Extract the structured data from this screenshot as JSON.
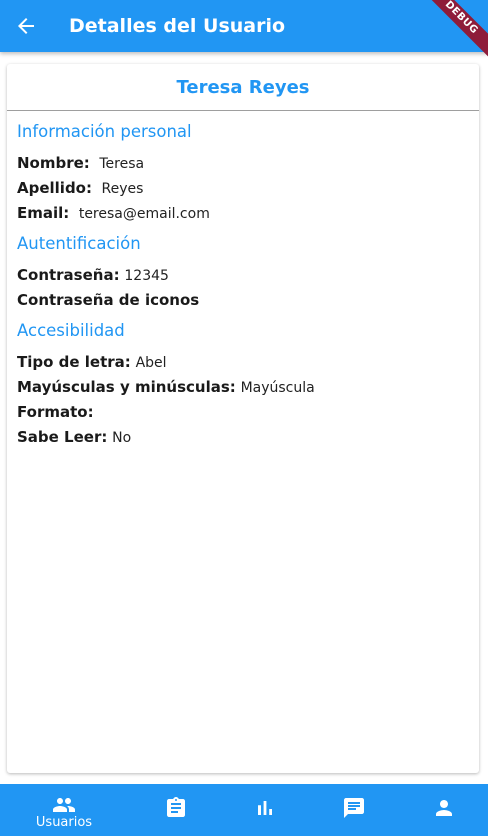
{
  "appbar": {
    "title": "Detalles del Usuario",
    "back_icon": "arrow-back-icon",
    "color": "#2196f3",
    "debug_label": "DEBUG"
  },
  "user": {
    "full_name": "Teresa Reyes"
  },
  "sections": {
    "personal": {
      "title": "Información personal",
      "nombre_label": "Nombre:",
      "nombre_value": "Teresa",
      "apellido_label": "Apellido:",
      "apellido_value": "Reyes",
      "email_label": "Email:",
      "email_value": "teresa@email.com"
    },
    "auth": {
      "title": "Autentificación",
      "password_label": "Contraseña:",
      "password_value": "12345",
      "icon_password_label": "Contraseña de iconos"
    },
    "accessibility": {
      "title": "Accesibilidad",
      "font_label": "Tipo de letra:",
      "font_value": "Abel",
      "case_label": "Mayúsculas y minúsculas:",
      "case_value": "Mayúscula",
      "format_label": "Formato:",
      "format_value": "",
      "reads_label": "Sabe Leer:",
      "reads_value": "No"
    }
  },
  "bottom_nav": {
    "items": [
      {
        "icon": "people-icon",
        "label": "Usuarios",
        "active": true
      },
      {
        "icon": "assignment-icon",
        "label": ""
      },
      {
        "icon": "bar-chart-icon",
        "label": ""
      },
      {
        "icon": "chat-icon",
        "label": ""
      },
      {
        "icon": "person-icon",
        "label": ""
      }
    ]
  }
}
